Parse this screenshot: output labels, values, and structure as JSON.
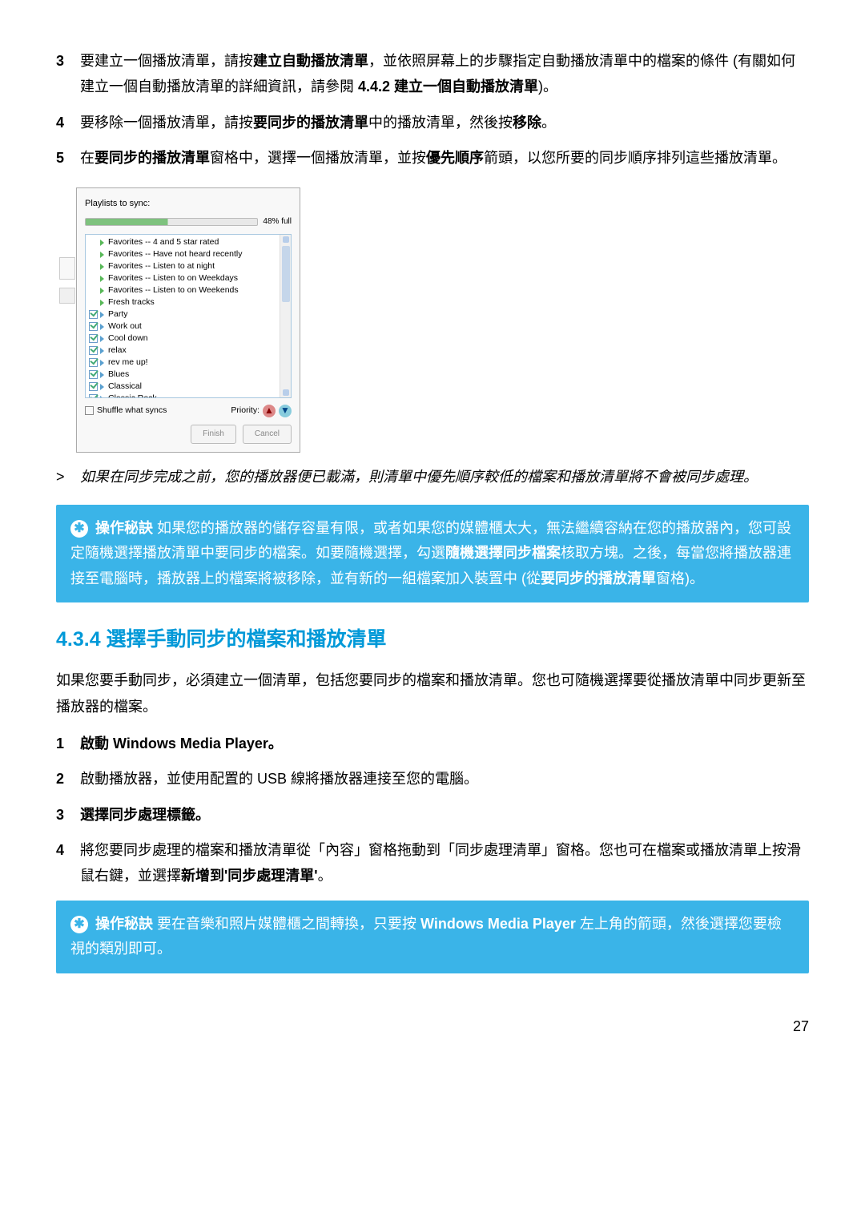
{
  "steps_top": [
    {
      "num": "3",
      "pre": "要建立一個播放清單，請按",
      "b1": "建立自動播放清單",
      "mid1": "，並依照屏幕上的步驟指定自動播放清單中的檔案的條件 (有關如何建立一個自動播放清單的詳細資訊，請參閱 ",
      "b2": "4.4.2 建立一個自動播放清單",
      "post": ")。"
    },
    {
      "num": "4",
      "pre": "要移除一個播放清單，請按",
      "b1": "要同步的播放清單",
      "mid1": "中的播放清單，然後按",
      "b2": "移除",
      "post": "。"
    },
    {
      "num": "5",
      "pre": "在",
      "b1": "要同步的播放清單",
      "mid1": "窗格中，選擇一個播放清單，並按",
      "b2": "優先順序",
      "post": "箭頭，以您所要的同步順序排列這些播放清單。"
    }
  ],
  "screenshot": {
    "title": "Playlists to sync:",
    "progress": "48% full",
    "favorites": [
      "Favorites -- 4 and 5 star rated",
      "Favorites -- Have not heard recently",
      "Favorites -- Listen to at night",
      "Favorites -- Listen to on Weekdays",
      "Favorites -- Listen to on Weekends",
      "Fresh tracks"
    ],
    "user_lists": [
      "Party",
      "Work out",
      "Cool down",
      "relax",
      "rev me up!",
      "Blues",
      "Classical",
      "Classic Rock"
    ],
    "shuffle": "Shuffle what syncs",
    "priority": "Priority:"
  },
  "note": {
    "marker": ">",
    "text": "如果在同步完成之前，您的播放器便已載滿，則清單中優先順序較低的檔案和播放清單將不會被同步處理。"
  },
  "tip1": {
    "label": "操作秘訣",
    "t1": " 如果您的播放器的儲存容量有限，或者如果您的媒體櫃太大，無法繼續容納在您的播放器內，您可設定隨機選擇播放清單中要同步的檔案。如要隨機選擇，勾選",
    "b1": "隨機選擇同步檔案",
    "t2": "核取方塊。之後，每當您將播放器連接至電腦時，播放器上的檔案將被移除，並有新的一組檔案加入裝置中 (從",
    "b2": "要同步的播放清單",
    "t3": "窗格)。"
  },
  "heading": "4.3.4 選擇手動同步的檔案和播放清單",
  "intro": "如果您要手動同步，必須建立一個清單，包括您要同步的檔案和播放清單。您也可隨機選擇要從播放清單中同步更新至播放器的檔案。",
  "steps_bot": [
    {
      "num": "1",
      "bold_all": true,
      "t1": "啟動 ",
      "b1": "Windows Media Player",
      "t2": "。"
    },
    {
      "num": "2",
      "t1": "啟動播放器，並使用配置的 USB 線將播放器連接至您的電腦。"
    },
    {
      "num": "3",
      "bold_all": true,
      "t1": "選擇",
      "b1": "同步處理",
      "t2": "標籤。"
    },
    {
      "num": "4",
      "t1": "將您要同步處理的檔案和播放清單從「內容」窗格拖動到「同步處理清單」窗格。您也可在檔案或播放清單上按滑鼠右鍵，並選擇",
      "b1": "新增到'同步處理清單'",
      "t2": "。"
    }
  ],
  "tip2": {
    "label": "操作秘訣",
    "t1": " 要在音樂和照片媒體櫃之間轉換，只要按 ",
    "b1": "Windows Media Player",
    "t2": " 左上角的箭頭，然後選擇您要檢視的類別即可。"
  },
  "page": "27"
}
